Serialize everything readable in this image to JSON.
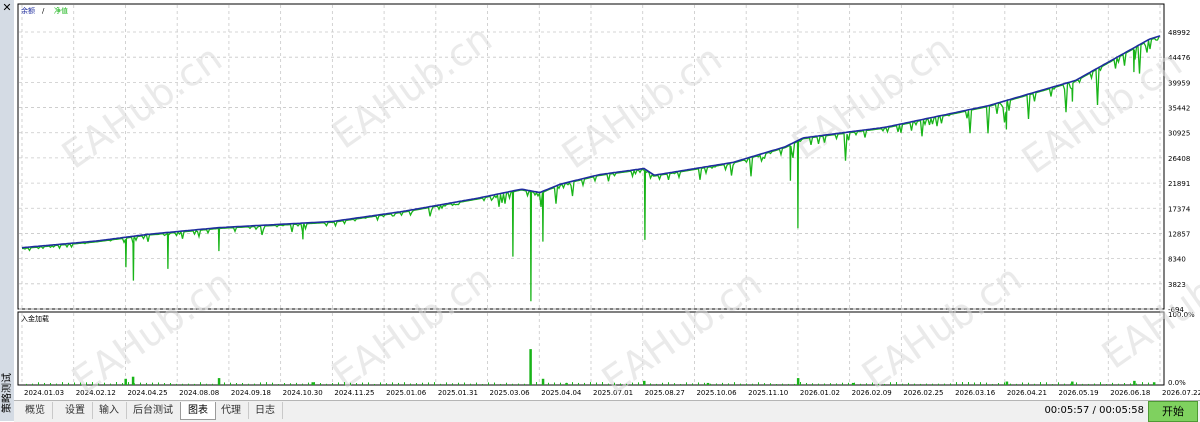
{
  "window": {
    "close_icon": "close-icon",
    "side_label": "策略测试"
  },
  "tabs": [
    {
      "label": "概览",
      "active": false
    },
    {
      "label": "设置",
      "active": false
    },
    {
      "label": "输入",
      "active": false
    },
    {
      "label": "后台测试",
      "active": false
    },
    {
      "label": "图表",
      "active": true
    },
    {
      "label": "代理",
      "active": false
    },
    {
      "label": "日志",
      "active": false
    }
  ],
  "status": {
    "timer": "00:05:57 / 00:05:58"
  },
  "start_button": {
    "label": "开始",
    "color": "#7fd15f"
  },
  "watermark": "EAHub.cn",
  "colors": {
    "balance": "#1f2d9e",
    "equity": "#18b418",
    "grid": "#c8c8c8"
  },
  "chart_data": [
    {
      "type": "line",
      "title": "",
      "legend": [
        {
          "name": "余额",
          "color": "#1f2d9e"
        },
        {
          "name": "净值",
          "color": "#18b418"
        }
      ],
      "yticks": [
        "48992",
        "44476",
        "39959",
        "35442",
        "30925",
        "26408",
        "21891",
        "17374",
        "12857",
        "8340",
        "3823",
        "-694"
      ],
      "ylim": [
        -694,
        48992
      ],
      "grid": true,
      "series": [
        {
          "name": "余额",
          "x": [
            "2024.01.03",
            "2024.03.15",
            "2024.06.10",
            "2024.09.10",
            "2024.11.25",
            "2025.01.15",
            "2025.02.28",
            "2025.03.25",
            "2025.04.05",
            "2025.05.10",
            "2025.07.10",
            "2025.08.28",
            "2025.09.05",
            "2025.11.01",
            "2025.12.20",
            "2026.01.06",
            "2026.02.20",
            "2026.04.10",
            "2026.05.30",
            "2026.07.15",
            "2026.07.22"
          ],
          "values": [
            10300,
            11500,
            12700,
            13900,
            15000,
            16800,
            19200,
            20800,
            20200,
            21700,
            23400,
            24500,
            23300,
            25600,
            28400,
            30000,
            31900,
            35800,
            40300,
            47700,
            48300
          ]
        },
        {
          "name": "净值",
          "drawdowns": [
            {
              "date": "2024.04.25",
              "low": 6800
            },
            {
              "date": "2024.05.10",
              "low": 4400
            },
            {
              "date": "2024.07.20",
              "low": 6500
            },
            {
              "date": "2024.09.10",
              "low": 9700
            },
            {
              "date": "2024.11.10",
              "low": 11800
            },
            {
              "date": "2025.03.20",
              "low": 8700
            },
            {
              "date": "2025.03.30",
              "low": 700
            },
            {
              "date": "2025.04.10",
              "low": 11400
            },
            {
              "date": "2025.08.28",
              "low": 11700
            },
            {
              "date": "2025.12.25",
              "low": 22300
            },
            {
              "date": "2026.01.02",
              "low": 13800
            },
            {
              "date": "2026.04.22",
              "low": 31500
            },
            {
              "date": "2026.05.28",
              "low": 36500
            },
            {
              "date": "2026.07.05",
              "low": 41800
            }
          ]
        }
      ]
    },
    {
      "type": "bar",
      "title": "入金加载",
      "yticks": [
        "100.0%",
        "0.0%"
      ],
      "ylim": [
        0,
        100
      ],
      "categories": [
        "2024.04.25",
        "2024.05.10",
        "2024.09.10",
        "2024.11.15",
        "2025.03.30",
        "2025.04.10",
        "2025.05.20",
        "2025.08.28",
        "2025.10.15",
        "2026.01.02",
        "2026.02.10",
        "2026.04.22",
        "2026.05.28",
        "2026.07.05",
        "2026.07.18"
      ],
      "values": [
        9,
        12,
        10,
        4,
        52,
        9,
        3,
        6,
        3,
        10,
        3,
        5,
        5,
        6,
        4
      ],
      "xticks": [
        "2024.01.03",
        "2024.02.12",
        "2024.04.25",
        "2024.08.08",
        "2024.09.18",
        "2024.10.30",
        "2024.11.25",
        "2025.01.06",
        "2025.01.31",
        "2025.03.06",
        "2025.04.04",
        "2025.07.01",
        "2025.08.27",
        "2025.10.06",
        "2025.11.10",
        "2026.01.02",
        "2026.02.09",
        "2026.02.25",
        "2026.03.16",
        "2026.04.21",
        "2026.05.19",
        "2026.06.18",
        "2026.07.22"
      ]
    }
  ]
}
